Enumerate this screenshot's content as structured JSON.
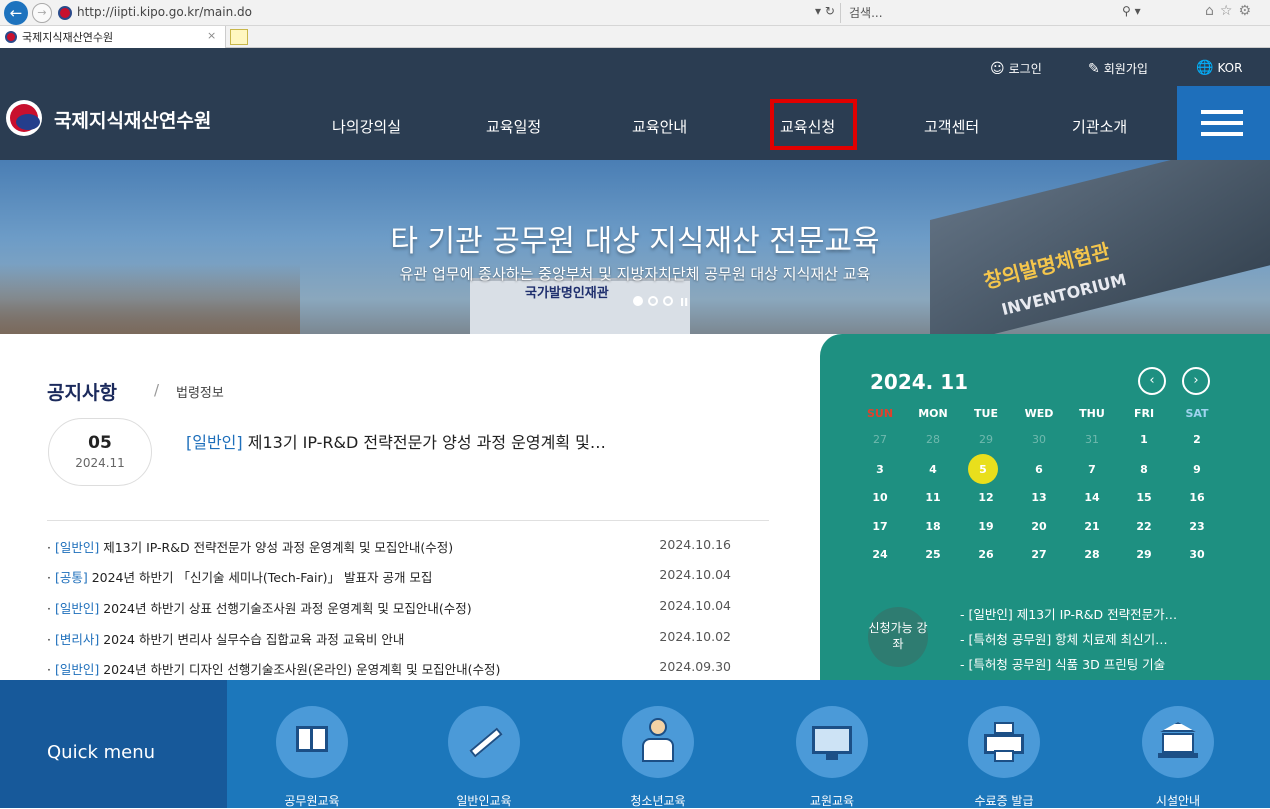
{
  "browser": {
    "url": "http://iipti.kipo.go.kr/main.do",
    "search_placeholder": "검색...",
    "tab_title": "국제지식재산연수원",
    "tab_close": "×"
  },
  "header": {
    "util": {
      "login": "로그인",
      "signup": "회원가입",
      "lang": "KOR"
    },
    "logo_text": "국제지식재산연수원",
    "nav": [
      "나의강의실",
      "교육일정",
      "교육안내",
      "교육신청",
      "고객센터",
      "기관소개"
    ],
    "highlight_color": "#e10000"
  },
  "hero": {
    "title": "타 기관 공무원 대상 지식재산 전문교육",
    "subtitle": "유관 업무에 종사하는 중앙부처 및 지방자치단체 공무원 대상 지식재산 교육",
    "sign_left": "국가발명인재관",
    "sign_right": "창의발명체험관",
    "sign_right_en": "INVENTORIUM"
  },
  "notice": {
    "title": "공지사항",
    "separator": "/",
    "tab2": "법령정보",
    "featured": {
      "day": "05",
      "ym": "2024.11",
      "category": "[일반인]",
      "title": " 제13기 IP-R&D 전략전문가 양성 과정 운영계획 및…"
    },
    "rows": [
      {
        "category": "[일반인]",
        "title": " 제13기 IP-R&D 전략전문가 양성 과정 운영계획 및 모집안내(수정)",
        "date": "2024.10.16"
      },
      {
        "category": "[공통]",
        "title": " 2024년 하반기 「신기술 세미나(Tech-Fair)」 발표자 공개 모집",
        "date": "2024.10.04"
      },
      {
        "category": "[일반인]",
        "title": " 2024년 하반기 상표 선행기술조사원 과정 운영계획 및 모집안내(수정)",
        "date": "2024.10.04"
      },
      {
        "category": "[변리사]",
        "title": " 2024 하반기 변리사 실무수습 집합교육 과정 교육비 안내",
        "date": "2024.10.02"
      },
      {
        "category": "[일반인]",
        "title": " 2024년 하반기 디자인 선행기술조사원(온라인) 운영계획 및 모집안내(수정)",
        "date": "2024.09.30"
      }
    ]
  },
  "calendar": {
    "title": "2024. 11",
    "prev": "‹",
    "next": "›",
    "dow": [
      "SUN",
      "MON",
      "TUE",
      "WED",
      "THU",
      "FRI",
      "SAT"
    ],
    "weeks": [
      [
        "27",
        "28",
        "29",
        "30",
        "31",
        "1",
        "2"
      ],
      [
        "3",
        "4",
        "5",
        "6",
        "7",
        "8",
        "9"
      ],
      [
        "10",
        "11",
        "12",
        "13",
        "14",
        "15",
        "16"
      ],
      [
        "17",
        "18",
        "19",
        "20",
        "21",
        "22",
        "23"
      ],
      [
        "24",
        "25",
        "26",
        "27",
        "28",
        "29",
        "30"
      ]
    ],
    "today": "5",
    "apply_badge": "신청가능 강좌",
    "apply_items": [
      "- [일반인] 제13기 IP-R&D 전략전문가…",
      "- [특허청 공무원] 항체 치료제 최신기…",
      "- [특허청 공무원] 식품 3D 프린팅 기술"
    ]
  },
  "quick_menu": {
    "label": "Quick menu",
    "items": [
      {
        "label": "공무원교육",
        "icon": "book-icon"
      },
      {
        "label": "일반인교육",
        "icon": "pencil-icon"
      },
      {
        "label": "청소년교육",
        "icon": "student-icon"
      },
      {
        "label": "교원교육",
        "icon": "monitor-icon"
      },
      {
        "label": "수료증 발급",
        "icon": "printer-icon"
      },
      {
        "label": "시설안내",
        "icon": "building-icon"
      }
    ]
  }
}
